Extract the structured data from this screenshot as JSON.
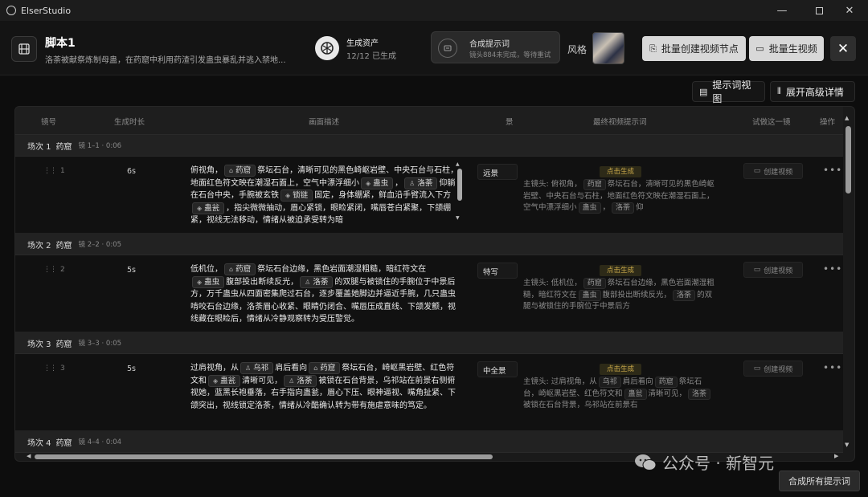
{
  "window": {
    "title": "ElserStudio"
  },
  "header": {
    "script_title": "脚本1",
    "script_desc": "洛荼被献祭炼制母蛊，在药窟中利用药渣引发蛊虫暴乱并逃入禁地...",
    "assets_title": "生成资产",
    "assets_stat": "12/12 已生成",
    "synth_title": "合成提示词",
    "synth_stat": "镜头884未完成，等待重试",
    "style_label": "风格",
    "batch_nodes_label": "批量创建视频节点",
    "batch_video_label": "批量生视频"
  },
  "toolbar": {
    "prompt_view_label": "提示词视图",
    "expand_label": "展开高级详情"
  },
  "table": {
    "columns": [
      "镜号",
      "生成时长",
      "画面描述",
      "景",
      "最终视频提示词",
      "试做这一镜",
      "操作"
    ],
    "scenes": [
      {
        "label": "场次 1",
        "loc": "药窟",
        "meta": "镜 1–1 · 0:06",
        "shot": {
          "no": "1",
          "dur": "6s",
          "type": "远景",
          "desc": [
            {
              "t": "俯视角，"
            },
            {
              "tag": "药窟",
              "icon": "loc"
            },
            {
              "t": "祭坛石台，清晰可见的黑色崎岖岩壁、中央石台与石柱，地面红色符文映在潮湿石面上，空气中漂浮细小"
            },
            {
              "tag": "蛊虫",
              "icon": "obj"
            },
            {
              "t": "，"
            },
            {
              "tag": "洛荼",
              "icon": "char"
            },
            {
              "t": "仰躺在石台中央，手腕被玄铁"
            },
            {
              "tag": "锁链",
              "icon": "obj"
            },
            {
              "t": "固定，身体绷紧，鲜血沿手臂流入下方"
            },
            {
              "tag": "蛊瓮",
              "icon": "obj"
            },
            {
              "t": "，指尖微微抽动，眉心紧锁，眼睑紧闭，嘴唇苍白紧聚，下颌绷紧，视线无法移动，情绪从被迫承受转为暗"
            }
          ],
          "prompt_chip": "点击生成",
          "prompt": [
            {
              "t": "主镜头: 俯视角，"
            },
            {
              "tag": "药窟"
            },
            {
              "t": "祭坛石台，清晰可见的黑色崎岖岩壁、中央石台与石柱，地面红色符文映在潮湿石面上，空气中漂浮细小"
            },
            {
              "tag": "蛊虫"
            },
            {
              "t": "，"
            },
            {
              "tag": "洛荼"
            },
            {
              "t": "仰"
            }
          ],
          "create_label": "创建视频"
        }
      },
      {
        "label": "场次 2",
        "loc": "药窟",
        "meta": "镜 2–2 · 0:05",
        "shot": {
          "no": "2",
          "dur": "5s",
          "type": "特写",
          "desc": [
            {
              "t": "低机位，"
            },
            {
              "tag": "药窟",
              "icon": "loc"
            },
            {
              "t": "祭坛石台边缘，黑色岩面潮湿粗糙，暗红符文在"
            },
            {
              "tag": "蛊虫",
              "icon": "obj"
            },
            {
              "t": "腹部投出断续反光，"
            },
            {
              "tag": "洛荼",
              "icon": "char"
            },
            {
              "t": "的双腿与被锁住的手腕位于中景后方，万千蛊虫从四面密集爬过石台，逐步覆盖她脚边并逼近手腕，几只蛊虫啃咬石台边缘，洛荼眉心收紧、眼睛仍闭合、嘴唇压成直线、下颌发颤，视线藏在眼睑后，情绪从冷静观察转为受压警觉。"
            }
          ],
          "prompt_chip": "点击生成",
          "prompt": [
            {
              "t": "主镜头: 低机位，"
            },
            {
              "tag": "药窟"
            },
            {
              "t": "祭坛石台边缘，黑色岩面潮湿粗糙，暗红符文在"
            },
            {
              "tag": "蛊虫"
            },
            {
              "t": "腹部投出断续反光，"
            },
            {
              "tag": "洛荼"
            },
            {
              "t": "的双腿与被锁住的手腕位于中景后方"
            }
          ],
          "create_label": "创建视频"
        }
      },
      {
        "label": "场次 3",
        "loc": "药窟",
        "meta": "镜 3–3 · 0:05",
        "shot": {
          "no": "3",
          "dur": "5s",
          "type": "中全景",
          "desc": [
            {
              "t": "过肩视角，从"
            },
            {
              "tag": "乌祁",
              "icon": "char"
            },
            {
              "t": "肩后看向"
            },
            {
              "tag": "药窟",
              "icon": "loc"
            },
            {
              "t": "祭坛石台，崎岖黑岩壁、红色符文和"
            },
            {
              "tag": "蛊瓮",
              "icon": "obj"
            },
            {
              "t": "清晰可见，"
            },
            {
              "tag": "洛荼",
              "icon": "char"
            },
            {
              "t": "被锁在石台背景，乌祁站在前景右侧俯视她，蓝黑长袍垂落，右手指向蛊瓮，眉心下压、眼神逼视、嘴角扯紧、下颌突出，视线锁定洛荼，情绪从冷酷确认转为带有施虐意味的笃定。"
            }
          ],
          "prompt_chip": "点击生成",
          "prompt": [
            {
              "t": "主镜头: 过肩视角，从"
            },
            {
              "tag": "乌祁"
            },
            {
              "t": "肩后看向"
            },
            {
              "tag": "药窟"
            },
            {
              "t": "祭坛石台，崎岖黑岩壁、红色符文和"
            },
            {
              "tag": "蛊瓮"
            },
            {
              "t": "清晰可见，"
            },
            {
              "tag": "洛荼"
            },
            {
              "t": "被锁在石台背景，乌祁站在前景右"
            }
          ],
          "create_label": "创建视频"
        }
      },
      {
        "label": "场次 4",
        "loc": "药窟",
        "meta": "镜 4–4 · 0:04"
      }
    ]
  },
  "footer": {
    "synth_all_label": "合成所有提示词",
    "watermark": "公众号 · 新智元"
  }
}
